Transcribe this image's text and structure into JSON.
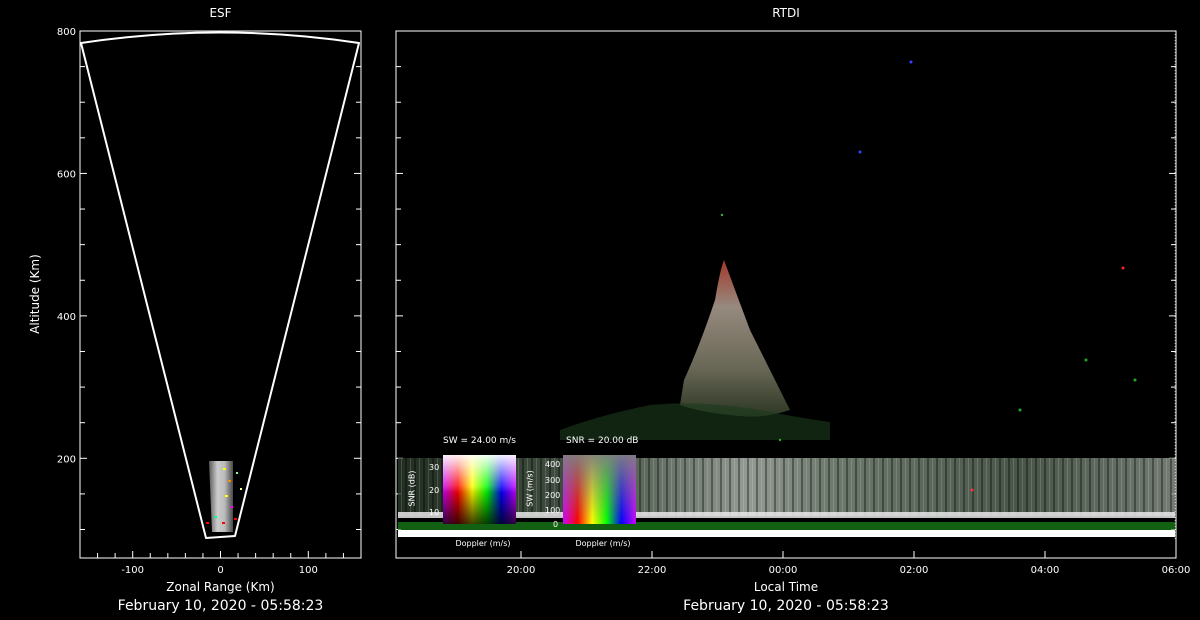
{
  "esf": {
    "title": "ESF",
    "xlabel": "Zonal Range (Km)",
    "ylabel": "Altitude (Km)",
    "date": "February 10, 2020 - 05:58:23"
  },
  "rtdi": {
    "title": "RTDI",
    "xlabel": "Local Time",
    "date": "February 10, 2020 - 05:58:23"
  },
  "legend_sw": {
    "title": "SW = 24.00 m/s",
    "ylabel": "SNR (dB)",
    "xlabel": "Doppler (m/s)",
    "yticks": [
      "30",
      "20",
      "10"
    ]
  },
  "legend_snr": {
    "title": "SNR = 20.00 dB",
    "ylabel": "SW (m/s)",
    "xlabel": "Doppler (m/s)",
    "yticks": [
      "400",
      "300",
      "200",
      "100",
      "0"
    ]
  },
  "chart_data": [
    {
      "type": "scatter",
      "title": "ESF",
      "xlabel": "Zonal Range (Km)",
      "ylabel": "Altitude (Km)",
      "xlim": [
        -160,
        160
      ],
      "ylim": [
        60,
        800
      ],
      "x_ticks": [
        -100,
        0,
        100
      ],
      "y_ticks": [
        200,
        400,
        600,
        800
      ],
      "fan_edges_at_800km": [
        -158,
        158
      ],
      "fan_apex_altitude": 80,
      "echo_region": {
        "x_range": [
          -15,
          15
        ],
        "altitude_range": [
          85,
          190
        ]
      }
    },
    {
      "type": "heatmap",
      "title": "RTDI",
      "xlabel": "Local Time",
      "x_tick_labels": [
        "20:00",
        "22:00",
        "00:00",
        "02:00",
        "04:00",
        "06:00"
      ],
      "ylim": [
        60,
        800
      ],
      "features": [
        {
          "name": "bottom-type layer",
          "altitude_range": [
            90,
            190
          ],
          "time_range": [
            "19:48",
            "06:00"
          ]
        },
        {
          "name": "plume",
          "peak_altitude": 460,
          "base_altitude": 210,
          "peak_time": "22:56"
        }
      ]
    }
  ]
}
